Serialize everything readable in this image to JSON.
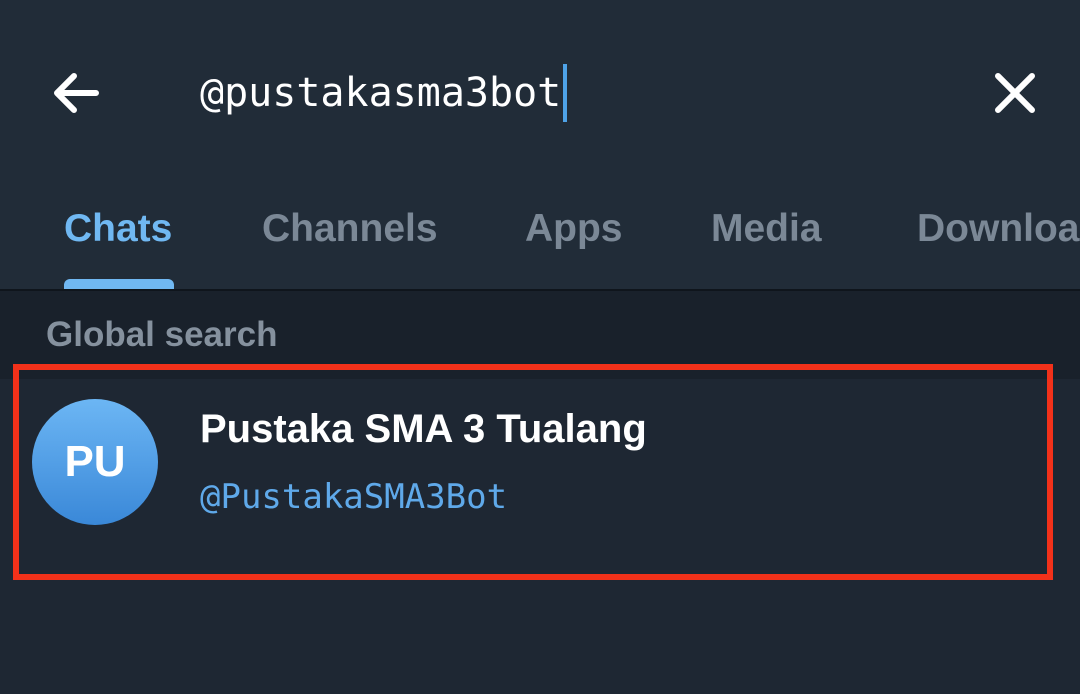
{
  "header": {
    "back_icon": "arrow-left-icon",
    "search_value": "@pustakasma3bot",
    "close_icon": "close-icon"
  },
  "tabs": [
    {
      "label": "Chats",
      "active": true
    },
    {
      "label": "Channels",
      "active": false
    },
    {
      "label": "Apps",
      "active": false
    },
    {
      "label": "Media",
      "active": false
    },
    {
      "label": "Downloa",
      "active": false
    }
  ],
  "section": {
    "title": "Global search"
  },
  "results": [
    {
      "avatar_initials": "PU",
      "name": "Pustaka SMA 3 Tualang",
      "username": "@PustakaSMA3Bot"
    }
  ],
  "colors": {
    "background": "#1e2733",
    "accent": "#70b8f2",
    "highlight": "#f2311a"
  }
}
